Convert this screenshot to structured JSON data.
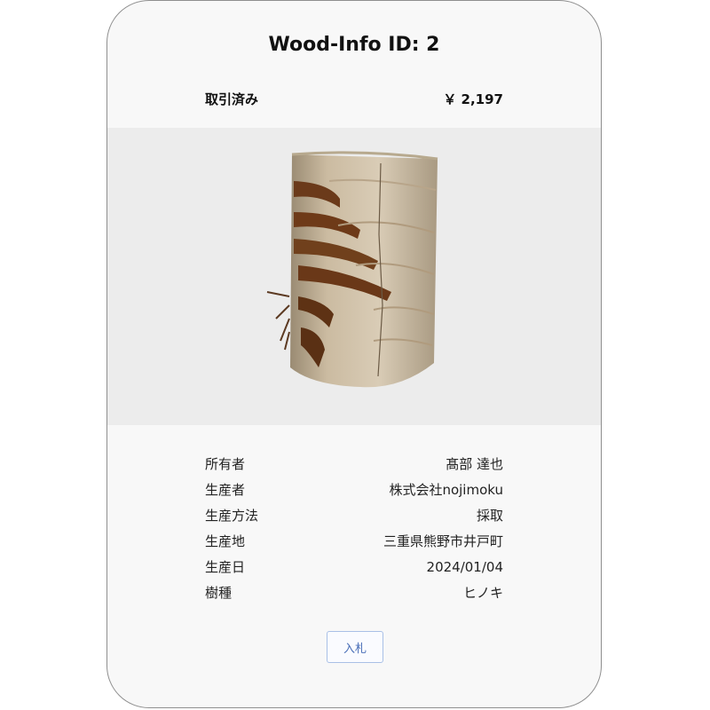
{
  "card": {
    "title": "Wood-Info ID: 2",
    "status": "取引済み",
    "price": "￥ 2,197"
  },
  "image": {
    "subject": "wood-log-icon"
  },
  "details": [
    {
      "label": "所有者",
      "value": "髙部 達也"
    },
    {
      "label": "生産者",
      "value": "株式会社nojimoku"
    },
    {
      "label": "生産方法",
      "value": "採取"
    },
    {
      "label": "生産地",
      "value": "三重県熊野市井戸町"
    },
    {
      "label": "生産日",
      "value": "2024/01/04"
    },
    {
      "label": "樹種",
      "value": "ヒノキ"
    }
  ],
  "actions": {
    "bid_label": "入札"
  }
}
